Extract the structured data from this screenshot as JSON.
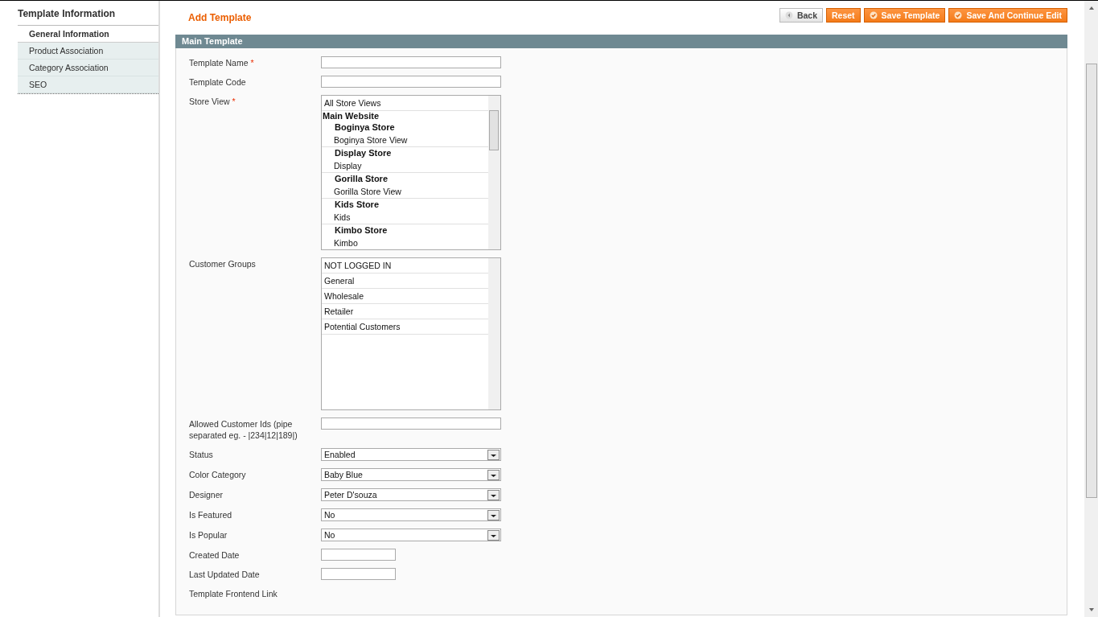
{
  "sidebar": {
    "title": "Template Information",
    "tabs": [
      {
        "label": "General Information",
        "selected": true
      },
      {
        "label": "Product Association",
        "selected": false
      },
      {
        "label": "Category Association",
        "selected": false
      },
      {
        "label": "SEO",
        "selected": false
      }
    ]
  },
  "header": {
    "title": "Add Template",
    "buttons": [
      {
        "label": "Back",
        "kind": "back"
      },
      {
        "label": "Reset",
        "kind": "plain"
      },
      {
        "label": "Save Template",
        "kind": "save"
      },
      {
        "label": "Save And Continue Edit",
        "kind": "save"
      }
    ]
  },
  "section": {
    "title": "Main Template",
    "fields": [
      {
        "kind": "text",
        "label": "Template Name",
        "required_mark": "*"
      },
      {
        "kind": "text",
        "label": "Template Code"
      },
      {
        "kind": "storelist",
        "label": "Store View",
        "required_mark": "*",
        "options": [
          {
            "label": "All Store Views"
          },
          {
            "label": "Main Website",
            "children": [
              {
                "label": "Boginya Store",
                "children": [
                  {
                    "label": "Boginya Store View"
                  }
                ]
              },
              {
                "label": "Display Store",
                "children": [
                  {
                    "label": "Display"
                  }
                ]
              },
              {
                "label": "Gorilla Store",
                "children": [
                  {
                    "label": "Gorilla Store View"
                  }
                ]
              },
              {
                "label": "Kids Store",
                "children": [
                  {
                    "label": "Kids"
                  }
                ]
              },
              {
                "label": "Kimbo Store",
                "children": [
                  {
                    "label": "Kimbo"
                  }
                ]
              }
            ]
          }
        ]
      },
      {
        "kind": "list",
        "label": "Customer Groups",
        "options": [
          {
            "label": "NOT LOGGED IN"
          },
          {
            "label": "General"
          },
          {
            "label": "Wholesale"
          },
          {
            "label": "Retailer"
          },
          {
            "label": "Potential Customers"
          }
        ]
      },
      {
        "kind": "text",
        "label": "Allowed Customer Ids (pipe separated eg. - |234|12|189|)"
      },
      {
        "kind": "select",
        "label": "Status",
        "value": "Enabled"
      },
      {
        "kind": "select",
        "label": "Color Category",
        "value": "Baby Blue"
      },
      {
        "kind": "select",
        "label": "Designer",
        "value": "Peter D'souza"
      },
      {
        "kind": "select",
        "label": "Is Featured",
        "value": "No"
      },
      {
        "kind": "select",
        "label": "Is Popular",
        "value": "No"
      },
      {
        "kind": "date",
        "label": "Created Date"
      },
      {
        "kind": "date",
        "label": "Last Updated Date"
      },
      {
        "kind": "none",
        "label": "Template Frontend Link"
      }
    ]
  }
}
